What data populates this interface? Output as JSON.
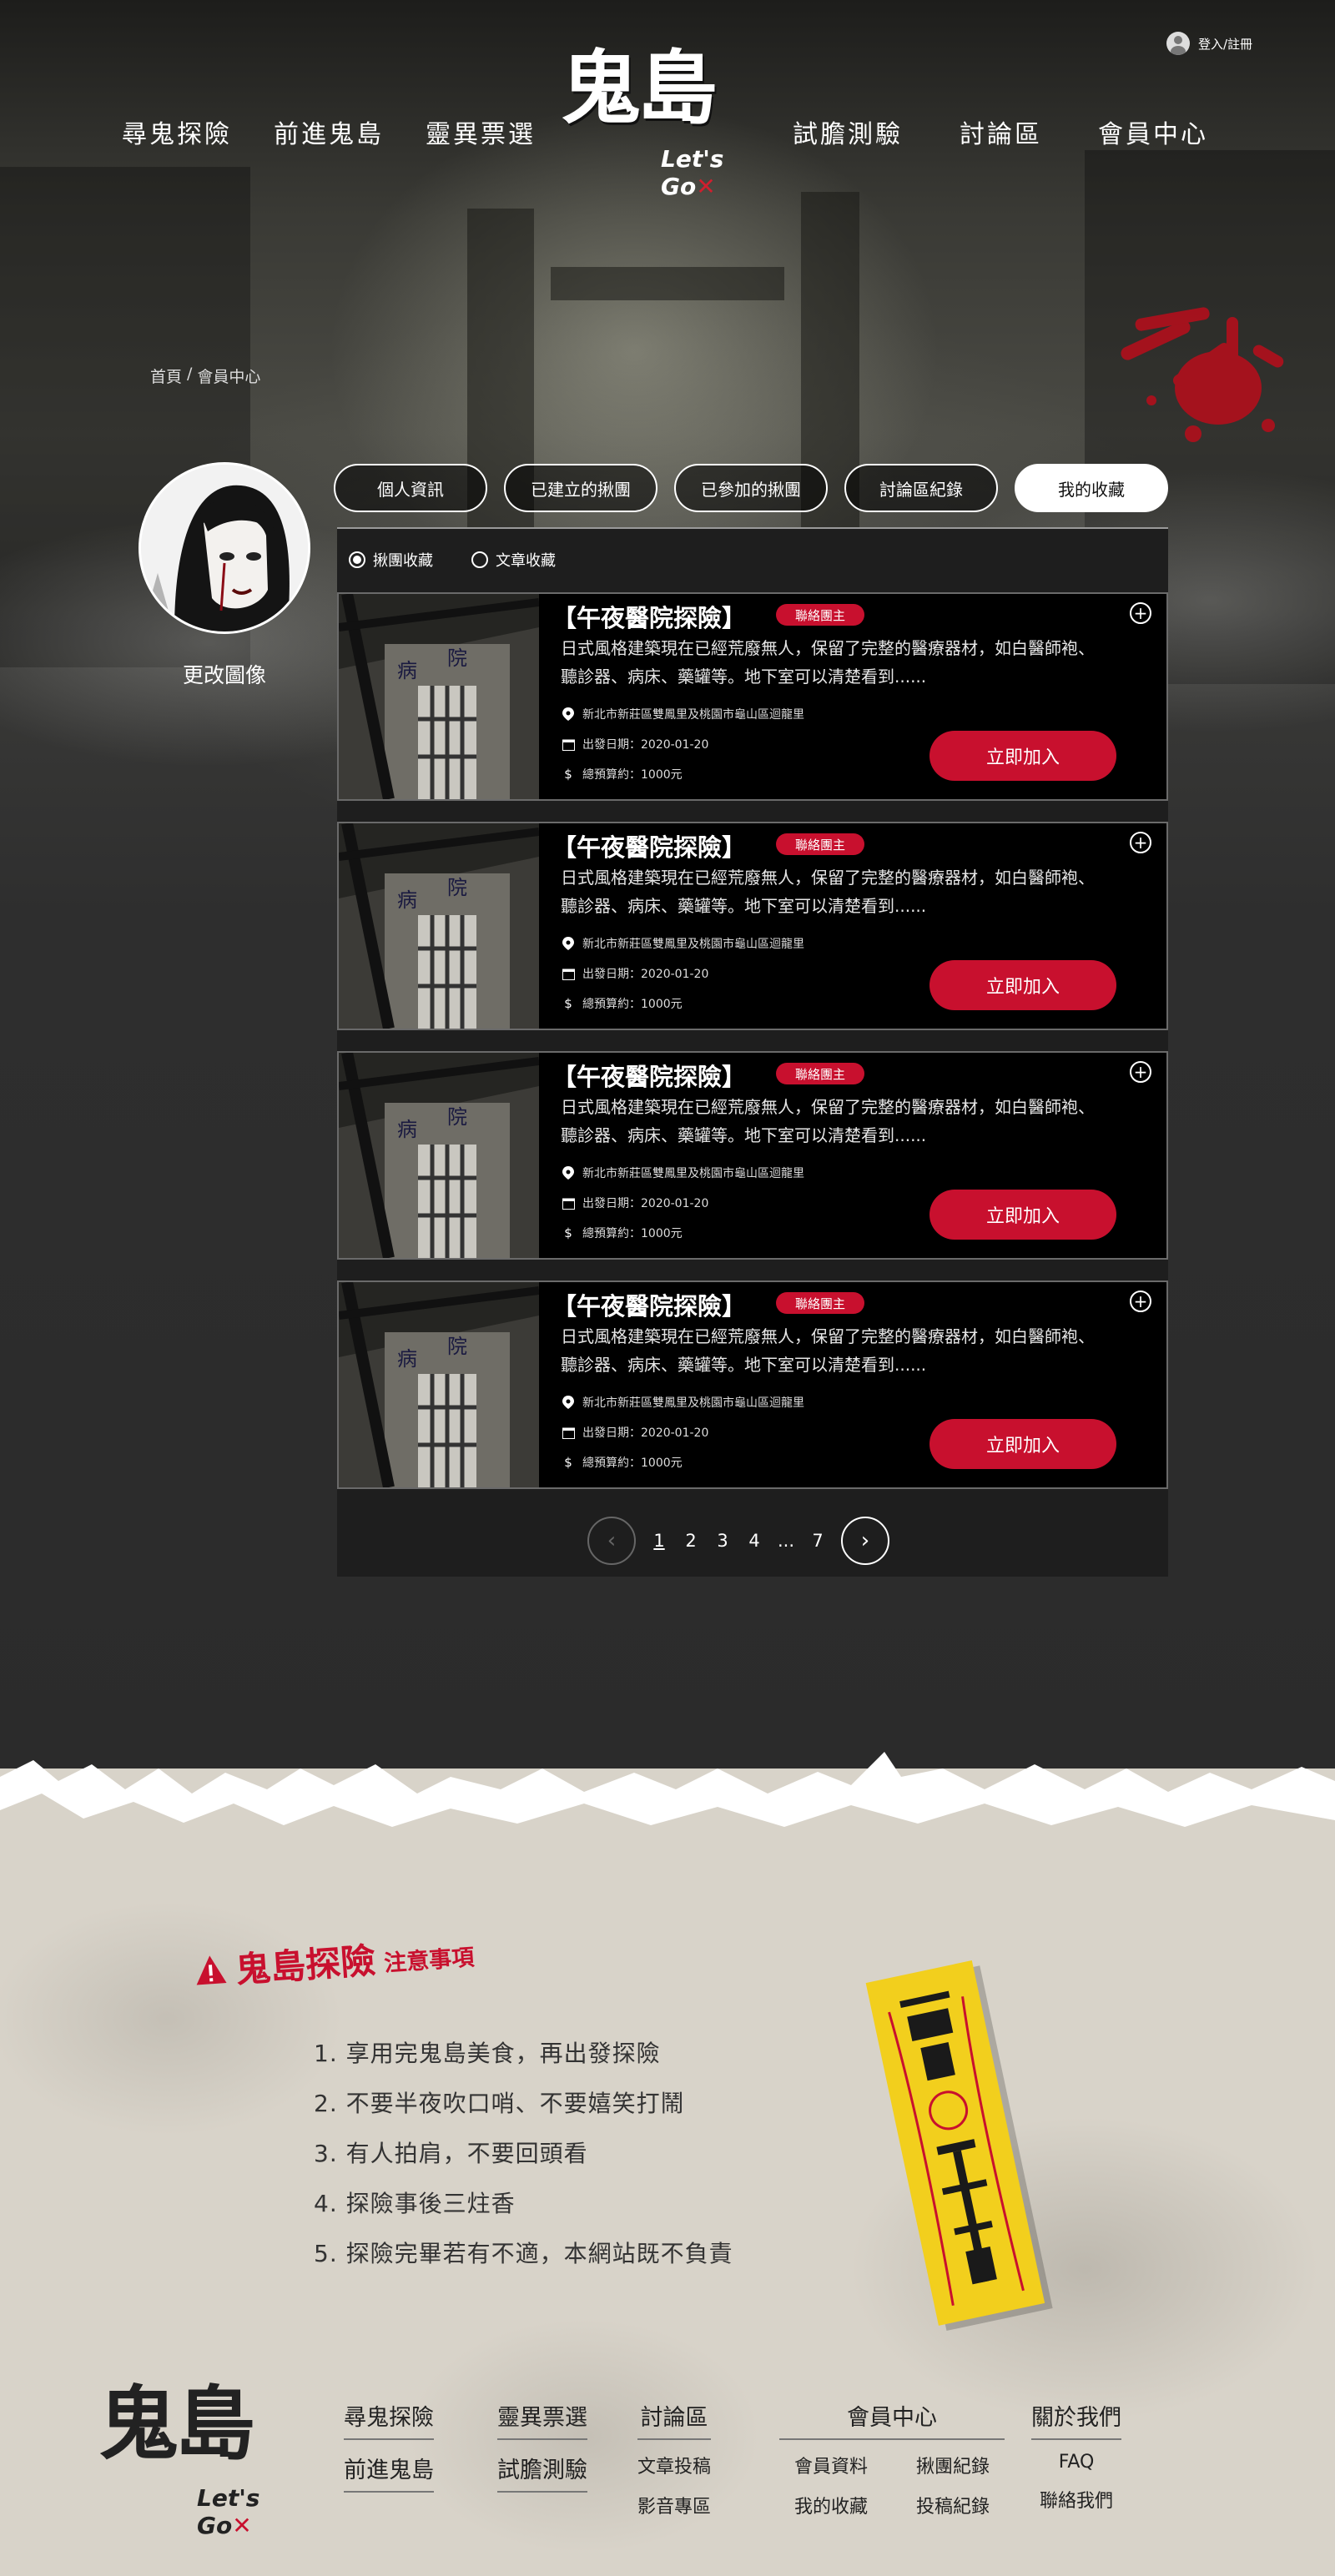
{
  "header": {
    "login_label": "登入/註冊",
    "nav_left": [
      "尋鬼探險",
      "前進鬼島",
      "靈異票選"
    ],
    "nav_right": [
      "試膽測驗",
      "討論區",
      "會員中心"
    ],
    "logo_main": "鬼島",
    "logo_sub": "Let's Go",
    "logo_x": "✕"
  },
  "breadcrumb": {
    "home": "首頁",
    "sep": "/",
    "current": "會員中心"
  },
  "profile": {
    "change_photo": "更改圖像"
  },
  "tabs": [
    {
      "label": "個人資訊",
      "active": false
    },
    {
      "label": "已建立的揪團",
      "active": false
    },
    {
      "label": "已參加的揪團",
      "active": false
    },
    {
      "label": "討論區紀錄",
      "active": false
    },
    {
      "label": "我的收藏",
      "active": true
    }
  ],
  "filters": [
    {
      "label": "揪團收藏",
      "checked": true
    },
    {
      "label": "文章收藏",
      "checked": false
    }
  ],
  "cards": [
    {
      "title": "【午夜醫院探險】",
      "tag": "聯絡團主",
      "desc": "日式風格建築現在已經荒廢無人，保留了完整的醫療器材，如白醫師袍、聽診器、病床、藥罐等。地下室可以清楚看到......",
      "location": "新北市新莊區雙鳳里及桃園市龜山區迴龍里",
      "date": "出發日期：2020-01-20",
      "budget": "總預算約：1000元",
      "join": "立即加入",
      "plus": "+"
    },
    {
      "title": "【午夜醫院探險】",
      "tag": "聯絡團主",
      "desc": "日式風格建築現在已經荒廢無人，保留了完整的醫療器材，如白醫師袍、聽診器、病床、藥罐等。地下室可以清楚看到......",
      "location": "新北市新莊區雙鳳里及桃園市龜山區迴龍里",
      "date": "出發日期：2020-01-20",
      "budget": "總預算約：1000元",
      "join": "立即加入",
      "plus": "+"
    },
    {
      "title": "【午夜醫院探險】",
      "tag": "聯絡團主",
      "desc": "日式風格建築現在已經荒廢無人，保留了完整的醫療器材，如白醫師袍、聽診器、病床、藥罐等。地下室可以清楚看到......",
      "location": "新北市新莊區雙鳳里及桃園市龜山區迴龍里",
      "date": "出發日期：2020-01-20",
      "budget": "總預算約：1000元",
      "join": "立即加入",
      "plus": "+"
    },
    {
      "title": "【午夜醫院探險】",
      "tag": "聯絡團主",
      "desc": "日式風格建築現在已經荒廢無人，保留了完整的醫療器材，如白醫師袍、聽診器、病床、藥罐等。地下室可以清楚看到......",
      "location": "新北市新莊區雙鳳里及桃園市龜山區迴龍里",
      "date": "出發日期：2020-01-20",
      "budget": "總預算約：1000元",
      "join": "立即加入",
      "plus": "+"
    }
  ],
  "pagination": {
    "prev": "‹",
    "next": "›",
    "pages": [
      "1",
      "2",
      "3",
      "4",
      "...",
      "7"
    ],
    "current": "1"
  },
  "notice": {
    "title_big": "鬼島探險",
    "title_small": "注意事項",
    "rules": [
      "1. 享用完鬼島美食，再出發探險",
      "2. 不要半夜吹口哨、不要嬉笑打鬧",
      "3. 有人拍肩，不要回頭看",
      "4. 探險事後三炷香",
      "5. 探險完畢若有不適，本網站既不負責"
    ]
  },
  "footer": {
    "logo_main": "鬼島",
    "logo_sub": "Let's Go",
    "col1": [
      "尋鬼探險",
      "前進鬼島"
    ],
    "col2": [
      "靈異票選",
      "試膽測驗"
    ],
    "col3": {
      "heading": "討論區",
      "links": [
        "文章投稿",
        "影音專區"
      ]
    },
    "col4": {
      "heading": "會員中心",
      "links": [
        "會員資料",
        "揪團紀錄",
        "我的收藏",
        "投稿紀錄"
      ]
    },
    "col5": {
      "heading": "關於我們",
      "links": [
        "FAQ",
        "聯絡我們"
      ]
    }
  },
  "colors": {
    "accent": "#c8102e",
    "dark": "#2b2b2b",
    "paper": "#d8d3c9"
  }
}
